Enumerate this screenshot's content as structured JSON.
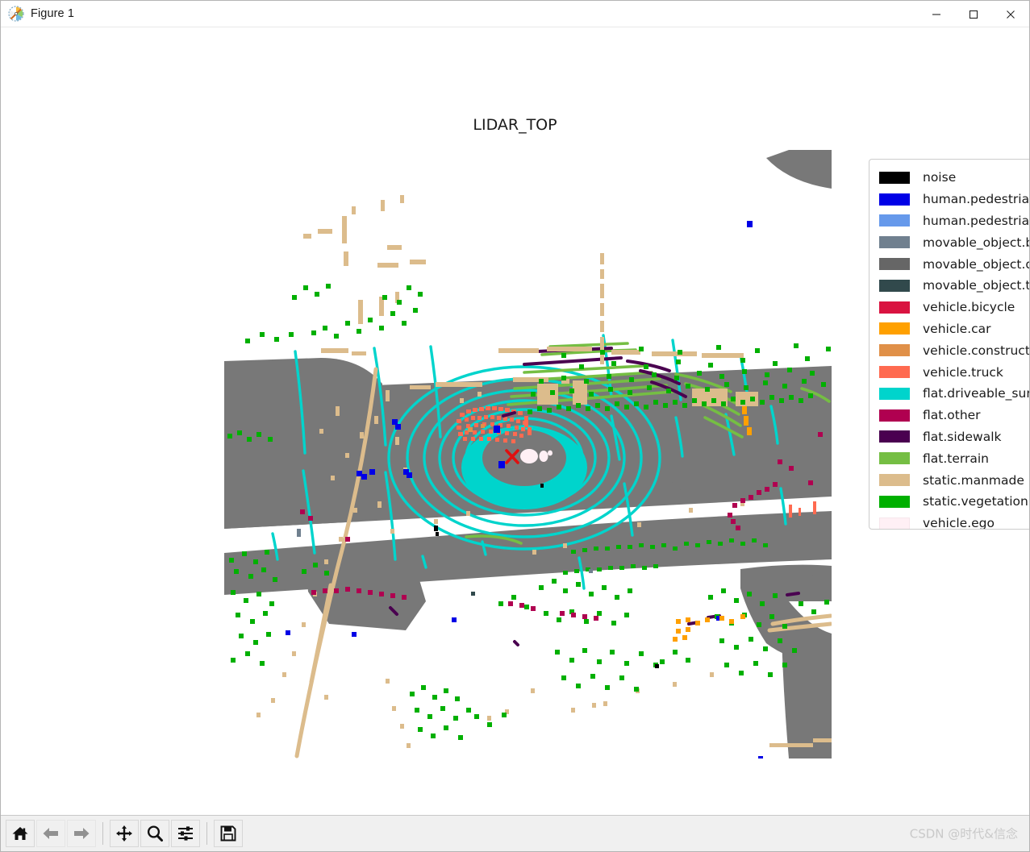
{
  "window": {
    "title": "Figure 1",
    "icon": "matplotlib-icon",
    "minimize_label": "—",
    "maximize_label": "□",
    "close_label": "✕"
  },
  "figure": {
    "title": "LIDAR_TOP",
    "background": "#ffffff"
  },
  "legend": {
    "items": [
      {
        "label": "noise",
        "color": "#000000"
      },
      {
        "label": "human.pedestrian.adult",
        "color": "#0000e6"
      },
      {
        "label": "human.pedestrian.child",
        "color": "#6699eb"
      },
      {
        "label": "movable_object.barrier",
        "color": "#70808f"
      },
      {
        "label": "movable_object.debris",
        "color": "#666666"
      },
      {
        "label": "movable_object.trafficcone",
        "color": "#31494c"
      },
      {
        "label": "vehicle.bicycle",
        "color": "#d91340"
      },
      {
        "label": "vehicle.car",
        "color": "#ffa000"
      },
      {
        "label": "vehicle.construction",
        "color": "#e09048"
      },
      {
        "label": "vehicle.truck",
        "color": "#ff6a50"
      },
      {
        "label": "flat.driveable_surface",
        "color": "#00d4cc"
      },
      {
        "label": "flat.other",
        "color": "#b00050"
      },
      {
        "label": "flat.sidewalk",
        "color": "#4a0050"
      },
      {
        "label": "flat.terrain",
        "color": "#75be43"
      },
      {
        "label": "static.manmade",
        "color": "#dcbc8c"
      },
      {
        "label": "static.vegetation",
        "color": "#00b000"
      },
      {
        "label": "vehicle.ego",
        "color": "#fff0f5"
      }
    ]
  },
  "toolbar": {
    "buttons": [
      {
        "name": "home-button",
        "icon": "home-icon",
        "enabled": true
      },
      {
        "name": "back-button",
        "icon": "back-arrow-icon",
        "enabled": false
      },
      {
        "name": "forward-button",
        "icon": "forward-arrow-icon",
        "enabled": false
      },
      {
        "name": "pan-button",
        "icon": "pan-move-icon",
        "enabled": true
      },
      {
        "name": "zoom-button",
        "icon": "magnifier-icon",
        "enabled": true
      },
      {
        "name": "configure-button",
        "icon": "sliders-icon",
        "enabled": true
      },
      {
        "name": "save-button",
        "icon": "floppy-disk-icon",
        "enabled": true
      }
    ]
  },
  "watermark": {
    "text": "CSDN @时代&信念"
  },
  "chart_data": {
    "type": "scatter",
    "title": "LIDAR_TOP",
    "xlabel": "",
    "ylabel": "",
    "grid": false,
    "legend_position": "right-outside",
    "description": "Bird's-eye-view LIDAR point cloud colored by nuScenes lidarseg semantic class. Ego vehicle at center with red X marker.",
    "classes": [
      "noise",
      "human.pedestrian.adult",
      "human.pedestrian.child",
      "movable_object.barrier",
      "movable_object.debris",
      "movable_object.trafficcone",
      "vehicle.bicycle",
      "vehicle.car",
      "vehicle.construction",
      "vehicle.truck",
      "flat.driveable_surface",
      "flat.other",
      "flat.sidewalk",
      "flat.terrain",
      "static.manmade",
      "static.vegetation",
      "vehicle.ego"
    ],
    "ego_marker": {
      "x": 0,
      "y": 0,
      "style": "x",
      "color": "#e01010"
    }
  }
}
